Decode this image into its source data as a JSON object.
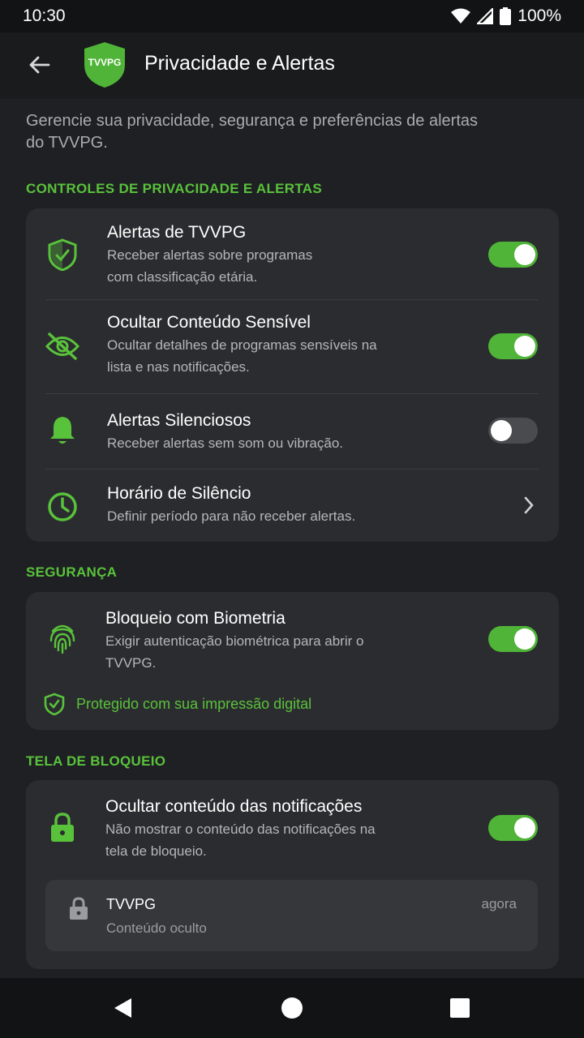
{
  "status": {
    "time": "10:30",
    "battery": "100%"
  },
  "appbar": {
    "title": "Privacidade e Alertas",
    "logo_text": "TVVPG"
  },
  "intro": "Gerencie sua privacidade, segurança e preferências de alertas do TVVPG.",
  "sections": {
    "privacy": {
      "title": "CONTROLES DE PRIVACIDADE E ALERTAS",
      "items": [
        {
          "title": "Alertas de TVVPG",
          "subtitle": "Receber alertas sobre programas com classificação etária.",
          "enabled": true,
          "icon": "shield-check-icon"
        },
        {
          "title": "Ocultar Conteúdo Sensível",
          "subtitle": "Ocultar detalhes de programas sensíveis na lista e nas notificações.",
          "enabled": true,
          "icon": "eye-off-icon"
        },
        {
          "title": "Alertas Silenciosos",
          "subtitle": "Receber alertas sem som ou vibração.",
          "enabled": false,
          "icon": "bell-icon"
        },
        {
          "title": "Horário de Silêncio",
          "subtitle": "Definir período para não receber alertas.",
          "icon": "clock-icon"
        }
      ]
    },
    "security": {
      "title": "SEGURANÇA",
      "item": {
        "title": "Bloqueio com Biometria",
        "subtitle": "Exigir autenticação biométrica para abrir o TVVPG.",
        "enabled": true,
        "icon": "fingerprint-icon"
      },
      "protected_text": "Protegido com sua impressão digital"
    },
    "lockscreen": {
      "title": "TELA DE BLOQUEIO",
      "item": {
        "title": "Ocultar conteúdo das notificações",
        "subtitle": "Não mostrar o conteúdo das notificações na tela de bloqueio.",
        "enabled": true,
        "icon": "lock-icon"
      },
      "preview": {
        "app": "TVVPG",
        "body": "Conteúdo oculto",
        "time": "agora"
      }
    }
  },
  "colors": {
    "accent": "#4fb437",
    "accent_text": "#59c23b",
    "background": "#1f2023",
    "card": "#2b2c2f"
  }
}
